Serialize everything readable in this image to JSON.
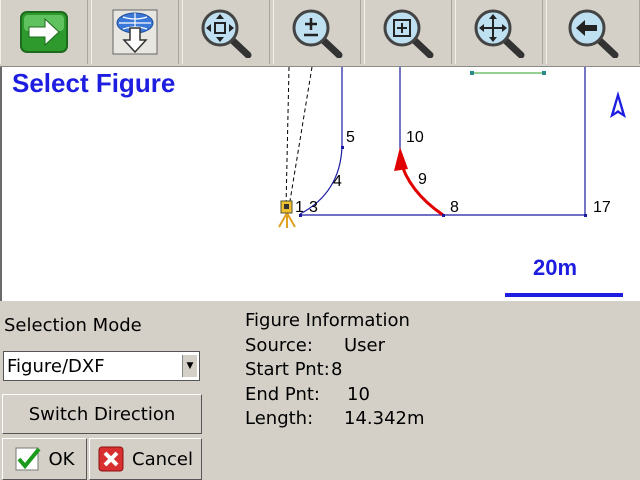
{
  "toolbar": {
    "buttons": [
      {
        "name": "accept-arrow-button",
        "icon": "green-right-arrow-icon"
      },
      {
        "name": "download-layer-button",
        "icon": "globe-down-arrow-icon"
      },
      {
        "name": "zoom-extents-button",
        "icon": "zoom-extents-icon"
      },
      {
        "name": "zoom-in-out-button",
        "icon": "zoom-plus-minus-icon"
      },
      {
        "name": "zoom-window-button",
        "icon": "zoom-window-icon"
      },
      {
        "name": "pan-button",
        "icon": "pan-move-icon"
      },
      {
        "name": "back-button",
        "icon": "back-arrow-icon"
      }
    ]
  },
  "map": {
    "title": "Select Figure",
    "scale_label": "20m",
    "point_labels": {
      "p5": "5",
      "p10": "10",
      "p4": "4",
      "p9": "9",
      "p1": "1",
      "p3": "3",
      "p8": "8",
      "p17": "17"
    },
    "colors": {
      "title": "#1e1ee0",
      "figure_line": "#1a1aa0",
      "selected": "#e00000",
      "north": "#1e1ee0"
    }
  },
  "selection": {
    "label": "Selection Mode",
    "mode_value": "Figure/DXF",
    "switch_label": "Switch Direction",
    "ok_label": "OK",
    "cancel_label": "Cancel"
  },
  "figure_info": {
    "heading": "Figure Information",
    "source_label": "Source:",
    "source_value": "User",
    "start_label": "Start Pnt:",
    "start_value": "8",
    "end_label": "End Pnt:",
    "end_value": "10",
    "length_label": "Length:",
    "length_value": "14.342m"
  }
}
